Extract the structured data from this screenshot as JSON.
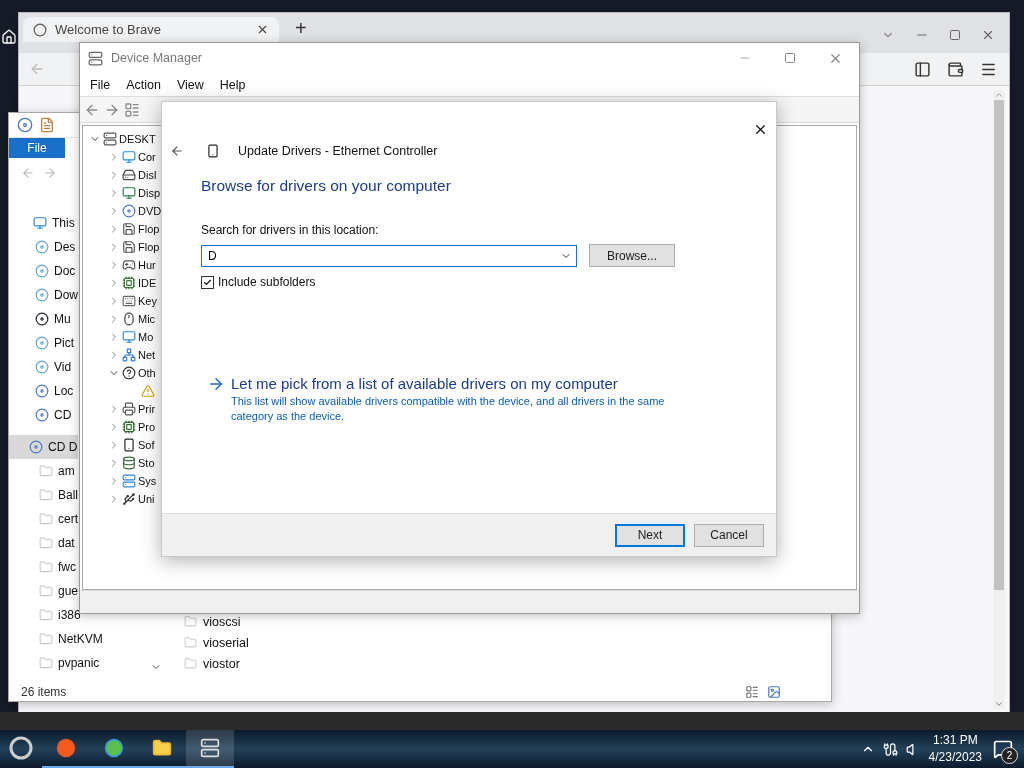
{
  "browser": {
    "tab_title": "Welcome to Brave",
    "new_tab": "+"
  },
  "explorer": {
    "ribbon_tab": "File",
    "nav_groups": [
      [
        {
          "label": "This",
          "kind": "pc",
          "selected": false
        },
        {
          "label": "Des",
          "kind": "library",
          "selected": false
        },
        {
          "label": "Doc",
          "kind": "library",
          "selected": false
        },
        {
          "label": "Dow",
          "kind": "library",
          "selected": false
        },
        {
          "label": "Mu",
          "kind": "music",
          "selected": false
        },
        {
          "label": "Pict",
          "kind": "library",
          "selected": false
        },
        {
          "label": "Vid",
          "kind": "library",
          "selected": false
        },
        {
          "label": "Loc",
          "kind": "disc",
          "selected": false
        },
        {
          "label": "CD",
          "kind": "disc",
          "selected": false
        }
      ],
      [
        {
          "label": "CD D",
          "kind": "disc",
          "selected": true
        },
        {
          "label": "am",
          "kind": "folder",
          "selected": false
        },
        {
          "label": "Ball",
          "kind": "folder",
          "selected": false
        },
        {
          "label": "cert",
          "kind": "folder",
          "selected": false
        },
        {
          "label": "dat",
          "kind": "folder",
          "selected": false
        },
        {
          "label": "fwc",
          "kind": "folder",
          "selected": false
        },
        {
          "label": "gue",
          "kind": "folder",
          "selected": false
        },
        {
          "label": "i386",
          "kind": "folder",
          "selected": false
        },
        {
          "label": "NetKVM",
          "kind": "folder",
          "selected": false
        },
        {
          "label": "pvpanic",
          "kind": "folder",
          "selected": false
        }
      ]
    ],
    "files": [
      "vioscsi",
      "vioserial",
      "viostor"
    ],
    "status": "26 items"
  },
  "device_manager": {
    "title": "Device Manager",
    "menu": [
      "File",
      "Action",
      "View",
      "Help"
    ],
    "tree": {
      "label": "DESKT",
      "kind": "computer-root",
      "expanded": true,
      "children": [
        {
          "label": "Cor",
          "kind": "computer",
          "expanded": false
        },
        {
          "label": "Disl",
          "kind": "disk",
          "expanded": false
        },
        {
          "label": "Disp",
          "kind": "display",
          "expanded": false
        },
        {
          "label": "DVD",
          "kind": "dvd",
          "expanded": false
        },
        {
          "label": "Flop",
          "kind": "floppy",
          "expanded": false
        },
        {
          "label": "Flop",
          "kind": "floppy",
          "expanded": false
        },
        {
          "label": "Hur",
          "kind": "hid",
          "expanded": false
        },
        {
          "label": "IDE",
          "kind": "ide",
          "expanded": false
        },
        {
          "label": "Key",
          "kind": "keyboard",
          "expanded": false
        },
        {
          "label": "Mic",
          "kind": "mouse",
          "expanded": false
        },
        {
          "label": "Mo",
          "kind": "monitor",
          "expanded": false
        },
        {
          "label": "Net",
          "kind": "network",
          "expanded": false
        },
        {
          "label": "Oth",
          "kind": "other",
          "expanded": true,
          "children": [
            {
              "kind": "warning"
            }
          ]
        },
        {
          "label": "Prir",
          "kind": "printer",
          "expanded": false
        },
        {
          "label": "Pro",
          "kind": "processor",
          "expanded": false
        },
        {
          "label": "Sof",
          "kind": "software",
          "expanded": false
        },
        {
          "label": "Sto",
          "kind": "storage",
          "expanded": false
        },
        {
          "label": "Sys",
          "kind": "system",
          "expanded": false
        },
        {
          "label": "Uni",
          "kind": "usb",
          "expanded": false
        }
      ]
    }
  },
  "dialog": {
    "title": "Update Drivers - Ethernet Controller",
    "heading": "Browse for drivers on your computer",
    "field_label": "Search for drivers in this location:",
    "path_value": "D",
    "browse": "Browse...",
    "include_subfolders": {
      "label": "Include subfolders",
      "checked": true
    },
    "pick_link": "Let me pick from a list of available drivers on my computer",
    "pick_description": "This list will show available drivers compatible with the device, and all drivers in the same category as the device.",
    "buttons": [
      {
        "label": "Next",
        "default": true
      },
      {
        "label": "Cancel",
        "default": false
      }
    ]
  },
  "taskbar": {
    "time": "1:31 PM",
    "date": "4/23/2023",
    "notifications": "2"
  }
}
